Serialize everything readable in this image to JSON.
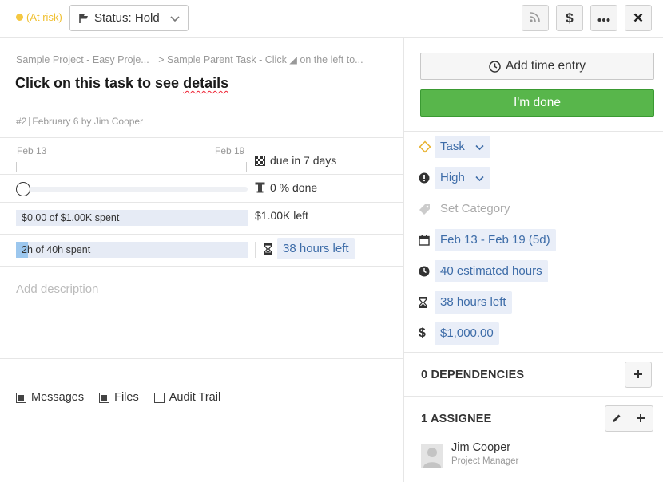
{
  "header": {
    "risk_label": "(At risk)",
    "status_label": "Status: Hold",
    "icons": [
      "rss-icon",
      "dollar-icon",
      "more-icon",
      "close-icon"
    ]
  },
  "task": {
    "breadcrumb_project": "Sample Project - Easy Proje...",
    "breadcrumb_parent": "> Sample Parent Task - Click ◢ on the left to...",
    "title_pre": "Click on this task to see ",
    "title_squiggle": "details",
    "number": "#2",
    "created": "February 6 by Jim Cooper"
  },
  "timeline": {
    "start": "Feb 13",
    "end": "Feb 19",
    "due_label": "due in 7 days",
    "progress_fraction": 0,
    "done_label": "0 % done"
  },
  "budget": {
    "spent_label": "$0.00 of $1.00K spent",
    "spent_fraction": 0,
    "left_label": "$1.00K left"
  },
  "hours": {
    "spent_label": "2h of 40h spent",
    "spent_fraction": 0.05,
    "left_label": "38 hours left"
  },
  "description_placeholder": "Add description",
  "tabs": [
    {
      "label": "Messages",
      "checked": true
    },
    {
      "label": "Files",
      "checked": true
    },
    {
      "label": "Audit Trail",
      "checked": false
    }
  ],
  "sidebar": {
    "add_time_label": "Add time entry",
    "done_label": "I'm done",
    "properties": {
      "type": "Task",
      "priority": "High",
      "category": "Set Category",
      "dates": "Feb 13 - Feb 19 (5d)",
      "estimate": "40 estimated hours",
      "hours_left": "38 hours left",
      "budget": "$1,000.00"
    },
    "dependencies_title": "0 DEPENDENCIES",
    "assignee_title": "1 ASSIGNEE",
    "assignee": {
      "name": "Jim Cooper",
      "role": "Project Manager"
    }
  },
  "colors": {
    "accent": "#3d6ca8",
    "done_green": "#58b64b",
    "risk_yellow": "#f5c842",
    "hours_fill": "#9cc7ee"
  }
}
